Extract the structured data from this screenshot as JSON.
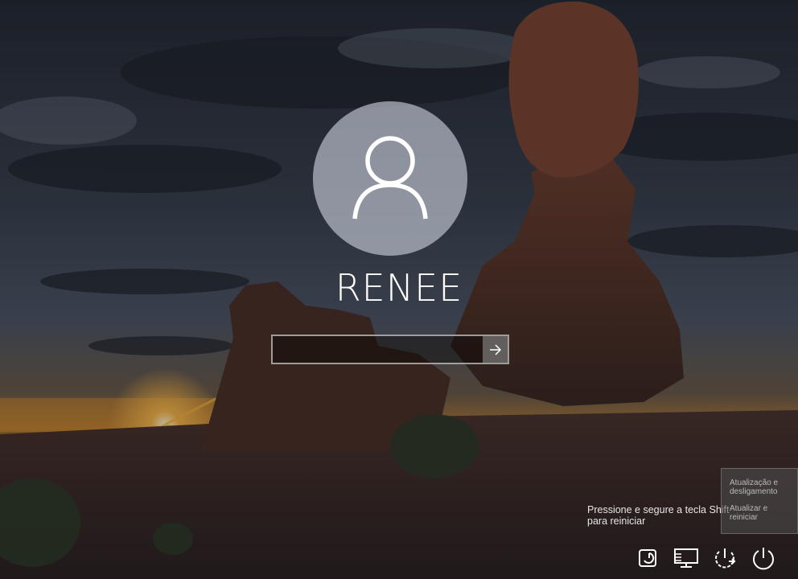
{
  "user": {
    "name": "RENEE",
    "avatar_icon": "user-icon"
  },
  "password": {
    "placeholder": "",
    "submit_icon": "arrow-right-icon"
  },
  "hint": {
    "text": "Pressione e segure a tecla Shift para reiniciar"
  },
  "power_menu": {
    "items": [
      {
        "label": "Atualização e desligamento"
      },
      {
        "label": "Atualizar e reiniciar"
      }
    ]
  },
  "bottom_icons": [
    {
      "name": "accessibility-icon"
    },
    {
      "name": "network-icon"
    },
    {
      "name": "update-power-icon"
    },
    {
      "name": "power-icon"
    }
  ],
  "colors": {
    "sky_top": "#2b3140",
    "sunset": "#f0b040",
    "rock": "#5a3c34",
    "avatar_bg": "#cdd2de",
    "submit_bg": "#7d7d7d"
  }
}
